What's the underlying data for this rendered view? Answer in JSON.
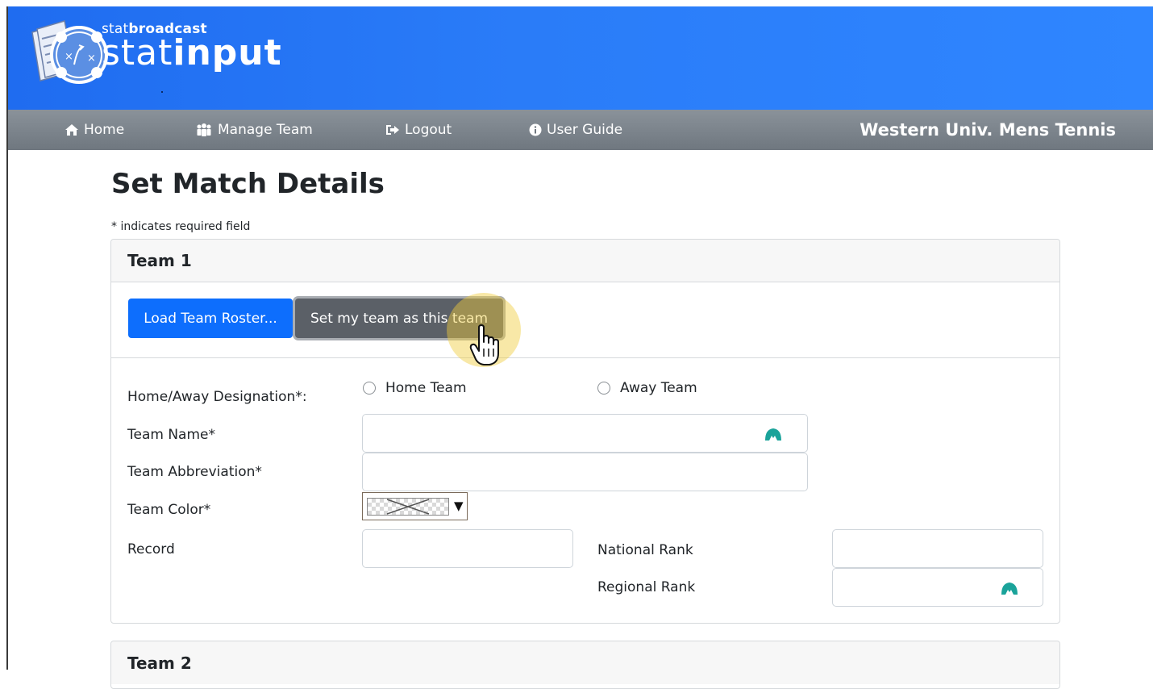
{
  "header": {
    "brand_small_pre": "stat",
    "brand_small_bold": "broadcast",
    "brand_big_pre": "stat",
    "brand_big_bold": "input"
  },
  "nav": {
    "items": [
      {
        "label": "Home",
        "icon": "home-icon"
      },
      {
        "label": "Manage Team",
        "icon": "users-icon"
      },
      {
        "label": "Logout",
        "icon": "logout-icon"
      },
      {
        "label": "User Guide",
        "icon": "info-icon"
      }
    ],
    "team_name": "Western Univ. Mens Tennis"
  },
  "page": {
    "title": "Set Match Details",
    "required_note": "* indicates required field"
  },
  "team1": {
    "header": "Team 1",
    "load_roster_label": "Load Team Roster...",
    "set_my_team_label": "Set my team as this team",
    "home_away_label": "Home/Away Designation*:",
    "home_option": "Home Team",
    "away_option": "Away Team",
    "team_name_label": "Team Name*",
    "team_name_value": "",
    "team_abbrev_label": "Team Abbreviation*",
    "team_abbrev_value": "",
    "team_color_label": "Team Color*",
    "record_label": "Record",
    "record_value": "",
    "national_rank_label": "National Rank",
    "national_rank_value": "",
    "regional_rank_label": "Regional Rank",
    "regional_rank_value": ""
  },
  "team2": {
    "header": "Team 2"
  },
  "colors": {
    "banner": "#2a7cf8",
    "navbar": "#7a828a",
    "primary_button": "#0d6efd",
    "dark_button": "#5b6067",
    "field_icon": "#1aa39a"
  }
}
